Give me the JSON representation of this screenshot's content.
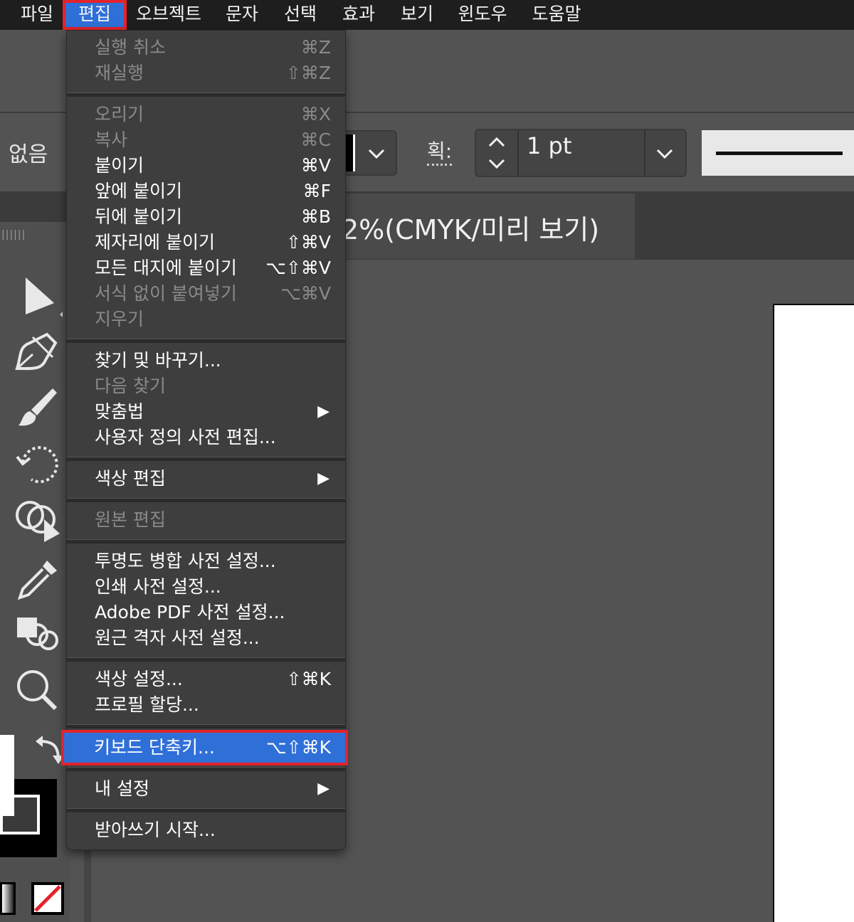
{
  "menubar": {
    "items": [
      "파일",
      "편집",
      "오브젝트",
      "문자",
      "선택",
      "효과",
      "보기",
      "윈도우",
      "도움말"
    ],
    "active_index": 1
  },
  "control": {
    "fill_label": "없음",
    "stroke_label": "획:",
    "stroke_value": "1 pt"
  },
  "document": {
    "title_partial": "2%(CMYK/미리 보기)"
  },
  "edit_menu": {
    "undo": {
      "label": "실행 취소",
      "shortcut": "⌘Z"
    },
    "redo": {
      "label": "재실행",
      "shortcut": "⇧⌘Z"
    },
    "cut": {
      "label": "오리기",
      "shortcut": "⌘X"
    },
    "copy": {
      "label": "복사",
      "shortcut": "⌘C"
    },
    "paste": {
      "label": "붙이기",
      "shortcut": "⌘V"
    },
    "paste_front": {
      "label": "앞에 붙이기",
      "shortcut": "⌘F"
    },
    "paste_back": {
      "label": "뒤에 붙이기",
      "shortcut": "⌘B"
    },
    "paste_in_place": {
      "label": "제자리에 붙이기",
      "shortcut": "⇧⌘V"
    },
    "paste_all_artboards": {
      "label": "모든 대지에 붙이기",
      "shortcut": "⌥⇧⌘V"
    },
    "paste_no_format": {
      "label": "서식 없이 붙여넣기",
      "shortcut": "⌥⌘V"
    },
    "clear": {
      "label": "지우기"
    },
    "find_replace": {
      "label": "찾기 및 바꾸기..."
    },
    "find_next": {
      "label": "다음 찾기"
    },
    "spelling": {
      "label": "맞춤법"
    },
    "edit_dictionary": {
      "label": "사용자 정의 사전 편집..."
    },
    "edit_colors": {
      "label": "색상 편집"
    },
    "edit_original": {
      "label": "원본 편집"
    },
    "transparency_presets": {
      "label": "투명도 병합 사전 설정..."
    },
    "print_presets": {
      "label": "인쇄 사전 설정..."
    },
    "pdf_presets": {
      "label": "Adobe PDF 사전 설정..."
    },
    "perspective_presets": {
      "label": "원근 격자 사전 설정..."
    },
    "color_settings": {
      "label": "색상 설정...",
      "shortcut": "⇧⌘K"
    },
    "assign_profile": {
      "label": "프로필 할당..."
    },
    "keyboard_shortcuts": {
      "label": "키보드 단축키...",
      "shortcut": "⌥⇧⌘K"
    },
    "my_settings": {
      "label": "내 설정"
    },
    "start_dictation": {
      "label": "받아쓰기 시작..."
    },
    "submenu_arrow": "▶"
  }
}
